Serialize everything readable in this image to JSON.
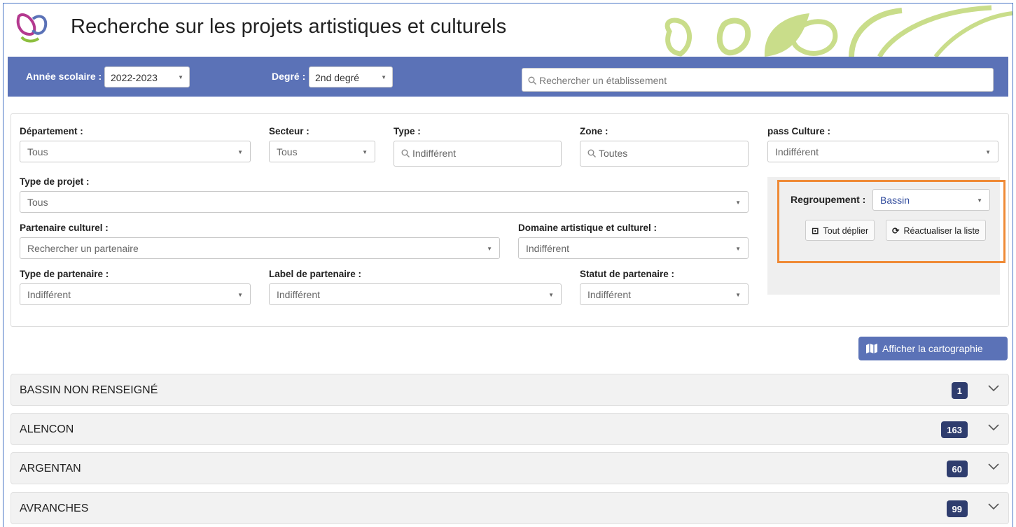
{
  "header": {
    "title": "Recherche sur les projets artistiques et culturels",
    "logo_icon": "culture-logo-icon"
  },
  "toolbar": {
    "annee_label": "Année scolaire :",
    "annee_value": "2022-2023",
    "degre_label": "Degré :",
    "degre_value": "2nd degré",
    "search_placeholder": "Rechercher un établissement"
  },
  "filters": {
    "departement": {
      "label": "Département :",
      "value": "Tous"
    },
    "secteur": {
      "label": "Secteur :",
      "value": "Tous"
    },
    "type": {
      "label": "Type :",
      "placeholder": "Indifférent"
    },
    "zone": {
      "label": "Zone :",
      "placeholder": "Toutes"
    },
    "pass_culture": {
      "label": "pass Culture :",
      "value": "Indifférent"
    },
    "type_projet": {
      "label": "Type de projet :",
      "value": "Tous"
    },
    "partenaire_culturel": {
      "label": "Partenaire culturel :",
      "placeholder": "Rechercher un partenaire"
    },
    "domaine": {
      "label": "Domaine artistique et culturel :",
      "value": "Indifférent"
    },
    "type_partenaire": {
      "label": "Type de partenaire :",
      "value": "Indifférent"
    },
    "label_partenaire": {
      "label": "Label de partenaire :",
      "value": "Indifférent"
    },
    "statut_partenaire": {
      "label": "Statut de partenaire :",
      "value": "Indifférent"
    }
  },
  "grouping": {
    "label": "Regroupement :",
    "value": "Bassin",
    "expand_label": "Tout déplier",
    "refresh_label": "Réactualiser la liste"
  },
  "map_button": {
    "label": "Afficher la cartographie"
  },
  "groups": [
    {
      "name": "BASSIN NON RENSEIGNÉ",
      "count": "1"
    },
    {
      "name": "ALENCON",
      "count": "163"
    },
    {
      "name": "ARGENTAN",
      "count": "60"
    },
    {
      "name": "AVRANCHES",
      "count": "99"
    }
  ],
  "colors": {
    "bar": "#5b72b7",
    "badge": "#2f3d6e",
    "highlight": "#ef8a36",
    "deco_green": "#c9dd8a"
  }
}
